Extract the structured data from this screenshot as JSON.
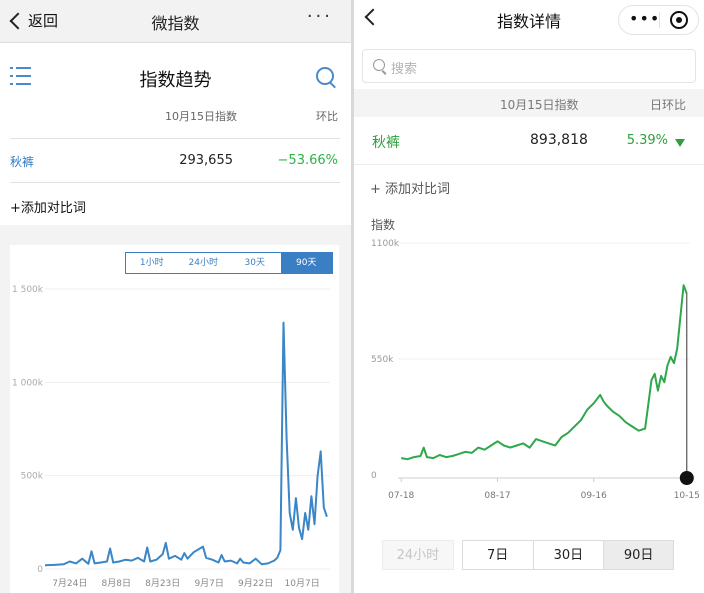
{
  "left": {
    "nav": {
      "back_label": "返回",
      "title": "微指数",
      "more": "···"
    },
    "heading": "指数趋势",
    "col_index": "10月15日指数",
    "col_ratio": "环比",
    "row": {
      "word": "秋裤",
      "value": "293,655",
      "change": "−53.66%"
    },
    "add_compare": "+添加对比词",
    "timeframes": [
      {
        "label": "1小时",
        "active": false
      },
      {
        "label": "24小时",
        "active": false
      },
      {
        "label": "30天",
        "active": false
      },
      {
        "label": "90天",
        "active": true
      }
    ],
    "colors": {
      "accent": "#3a7fc4",
      "negative": "#2fb14a"
    }
  },
  "left_chart_data": {
    "type": "line",
    "y_ticks": [
      "1 500k",
      "1 000k",
      "500k",
      "0"
    ],
    "y_tick_values": [
      1500,
      1000,
      500,
      0
    ],
    "ylim": [
      0,
      1500
    ],
    "x_ticks": [
      {
        "label": "7月24日",
        "day": 8
      },
      {
        "label": "8月8日",
        "day": 23
      },
      {
        "label": "8月23日",
        "day": 38
      },
      {
        "label": "9月7日",
        "day": 53
      },
      {
        "label": "9月22日",
        "day": 68
      },
      {
        "label": "10月7日",
        "day": 83
      }
    ],
    "xlim": [
      0,
      92
    ],
    "x": [
      0,
      3,
      6,
      8,
      10,
      12,
      14,
      15,
      16,
      18,
      20,
      21,
      22,
      24,
      26,
      28,
      30,
      32,
      33,
      34,
      36,
      38,
      39,
      40,
      42,
      44,
      45,
      46,
      48,
      50,
      51,
      52,
      54,
      56,
      57,
      58,
      60,
      62,
      63,
      64,
      66,
      68,
      70,
      72,
      74,
      75,
      76,
      77,
      78,
      79,
      80,
      81,
      82,
      83,
      84,
      85,
      86,
      87,
      88,
      89,
      90,
      91
    ],
    "values": [
      20,
      22,
      25,
      40,
      30,
      55,
      28,
      95,
      30,
      35,
      40,
      110,
      35,
      40,
      50,
      45,
      60,
      40,
      115,
      40,
      50,
      80,
      140,
      55,
      70,
      50,
      85,
      55,
      90,
      110,
      120,
      60,
      50,
      35,
      75,
      40,
      45,
      30,
      55,
      35,
      30,
      55,
      25,
      30,
      45,
      60,
      100,
      1320,
      700,
      300,
      210,
      380,
      220,
      160,
      300,
      210,
      390,
      240,
      500,
      630,
      330,
      280
    ],
    "unit": "k",
    "line_color": "#3a86c6"
  },
  "right": {
    "title": "指数详情",
    "search_placeholder": "搜索",
    "col_index": "10月15日指数",
    "col_ratio": "日环比",
    "row": {
      "word": "秋裤",
      "value": "893,818",
      "change": "5.39%"
    },
    "add_compare": "+ 添加对比词",
    "tabs": [
      {
        "label": "24小时",
        "state": "disabled"
      },
      {
        "label": "7日",
        "state": "normal"
      },
      {
        "label": "30日",
        "state": "normal"
      },
      {
        "label": "90日",
        "state": "active"
      }
    ],
    "colors": {
      "accent": "#2e9e3e"
    }
  },
  "right_chart_data": {
    "type": "line",
    "ylabel": "指数",
    "y_ticks": [
      "1100k",
      "550k",
      "0"
    ],
    "y_tick_values": [
      1100,
      550,
      0
    ],
    "ylim": [
      0,
      1100
    ],
    "x_ticks": [
      {
        "label": "07-18",
        "day": 0
      },
      {
        "label": "08-17",
        "day": 30
      },
      {
        "label": "09-16",
        "day": 60
      },
      {
        "label": "10-15",
        "day": 89
      }
    ],
    "xlim": [
      -1,
      90
    ],
    "x": [
      0,
      2,
      4,
      6,
      7,
      8,
      10,
      12,
      14,
      16,
      18,
      20,
      22,
      24,
      26,
      28,
      30,
      32,
      34,
      36,
      38,
      40,
      42,
      44,
      46,
      48,
      50,
      52,
      54,
      56,
      58,
      60,
      62,
      63,
      64,
      66,
      68,
      70,
      72,
      74,
      76,
      78,
      79,
      80,
      81,
      82,
      83,
      84,
      85,
      86,
      87,
      88,
      89
    ],
    "values": [
      80,
      75,
      85,
      90,
      130,
      85,
      80,
      95,
      85,
      90,
      100,
      110,
      105,
      130,
      120,
      140,
      160,
      140,
      130,
      140,
      150,
      130,
      170,
      160,
      150,
      140,
      180,
      200,
      230,
      260,
      310,
      340,
      380,
      350,
      330,
      300,
      280,
      250,
      230,
      210,
      220,
      450,
      480,
      400,
      470,
      440,
      520,
      560,
      530,
      600,
      750,
      900,
      860
    ],
    "marker_day": 89,
    "line_color": "#2ea84a"
  }
}
